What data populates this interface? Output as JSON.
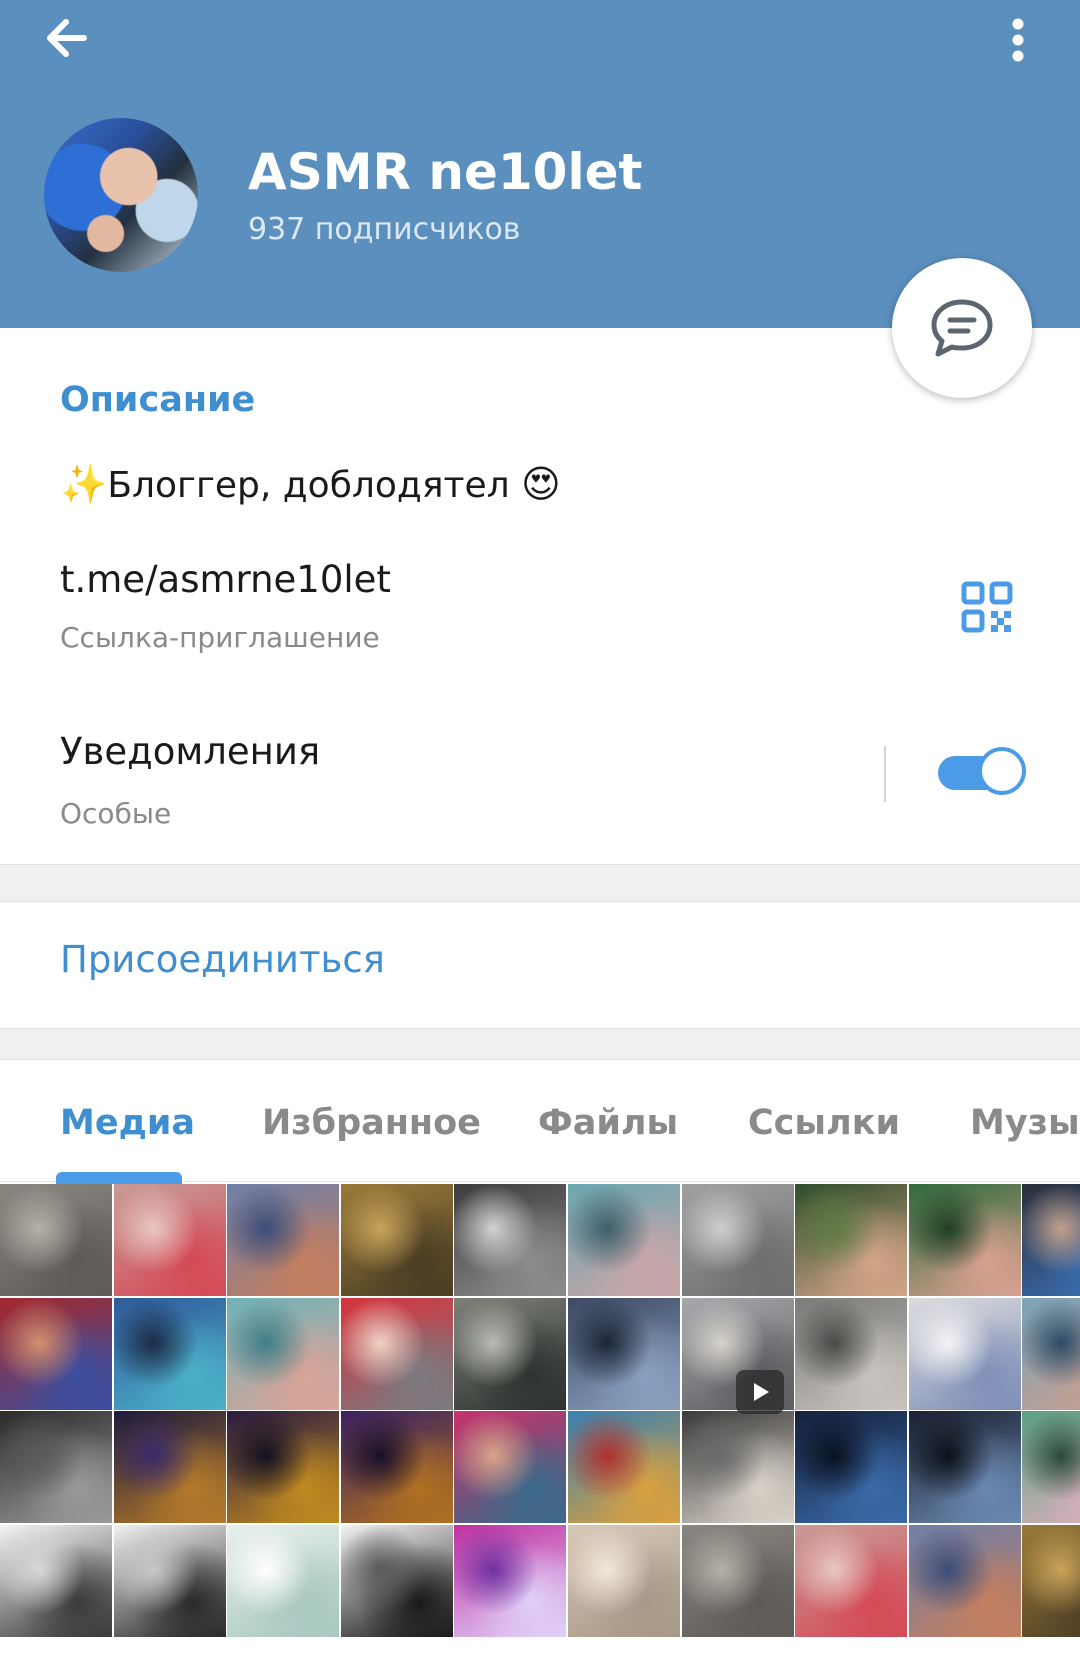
{
  "header": {
    "back_icon": "arrow-left-icon",
    "more_icon": "more-vertical-icon",
    "title": "ASMR ne10let",
    "subscribers": "937 подписчиков",
    "background_color": "#5a8fbe",
    "fab_icon": "chat-bubble-icon"
  },
  "info": {
    "section_title": "Описание",
    "description_emoji_start": "✨",
    "description_text": "Блоггер, доблодятел",
    "description_emoji_end": "😍",
    "link": "t.me/asmrne10let",
    "link_caption": "Ссылка-приглашение",
    "qr_icon": "qr-code-icon",
    "notifications_title": "Уведомления",
    "notifications_caption": "Особые",
    "notifications_enabled": true
  },
  "actions": {
    "join": "Присоединиться"
  },
  "tabs": {
    "items": [
      "Медиа",
      "Избранное",
      "Файлы",
      "Ссылки",
      "Музык"
    ],
    "active_index": 0
  },
  "accent_color": "#4c9be6",
  "media_grid": {
    "play_icon": "play-icon"
  }
}
